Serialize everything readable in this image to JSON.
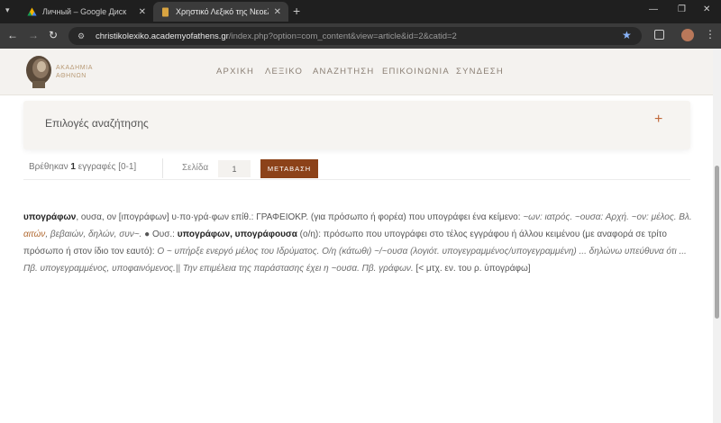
{
  "browser": {
    "tabs": [
      {
        "title": "Личный – Google Диск",
        "active": false
      },
      {
        "title": "Χρηστικό Λεξικό της Νεοελληνικής",
        "active": true
      }
    ],
    "url_host": "christikolexiko.academyofathens.gr",
    "url_path": "/index.php?option=com_content&view=article&id=2&catid=2"
  },
  "site": {
    "logo_text_line1": "ΑΚΑΔΗΜΙΑ",
    "logo_text_line2": "ΑΘΗΝΩΝ",
    "nav": [
      "ΑΡΧΙΚΗ",
      "ΛΕΞΙΚΟ",
      "ΑΝΑΖΗΤΗΣΗ",
      "ΕΠΙΚΟΙΝΩΝΙΑ",
      "ΣΥΝΔΕΣΗ"
    ]
  },
  "search_panel": {
    "title": "Επιλογές αναζήτησης",
    "toggle": "+"
  },
  "results": {
    "found_prefix": "Βρέθηκαν",
    "found_count": "1",
    "found_suffix": "εγγραφές [0-1]",
    "page_label": "Σελίδα",
    "page_value": "1",
    "go_label": "ΜΕΤΑΒΑΣΗ"
  },
  "entry": {
    "s1": "υπογράφων",
    "s2": ", ουσα, ον [ιπογράφων] υ·πο·γρά·φων επίθ.: ΓΡΑΦΕΙΟΚΡ. (για πρόσωπο ή φορέα) που υπογράφει ένα κείμενο: ",
    "s3": "~ων: ιατρός. ~ουσα: Αρχή. ~ον: μέλος. Βλ.",
    "s4": "αιτών",
    "s5": ", βεβαιών, δηλών, συν~.",
    "s6": " ● Ουσ.: ",
    "s7": "υπογράφων, υπογράφουσα",
    "s8": " (ο/η): πρόσωπο που υπογράφει στο τέλος εγγράφου ή άλλου κειμένου (με αναφορά σε τρίτο πρόσωπο ή στον ίδιο τον εαυτό): ",
    "s9": "Ο ~ υπήρξε ενεργό μέλος του Ιδρύματος. Ο/η (κάτωθι) ~/~ουσα (λογιότ. υπογεγραμμένος/υπογεγραμμένη) ... δηλώνω υπεύθυνα ότι ... Πβ. υπογεγραμμένος, υποφαινόμενος.||",
    "s10": " Την επιμέλεια της παράστασης έχει η ~ουσα. Πβ. γράφων.",
    "s11": " [< μτχ. εν. του ρ. ὑπογράφω]"
  },
  "colors": {
    "accent": "#8c4219",
    "link": "#b0682f",
    "plus": "#c0683a"
  }
}
